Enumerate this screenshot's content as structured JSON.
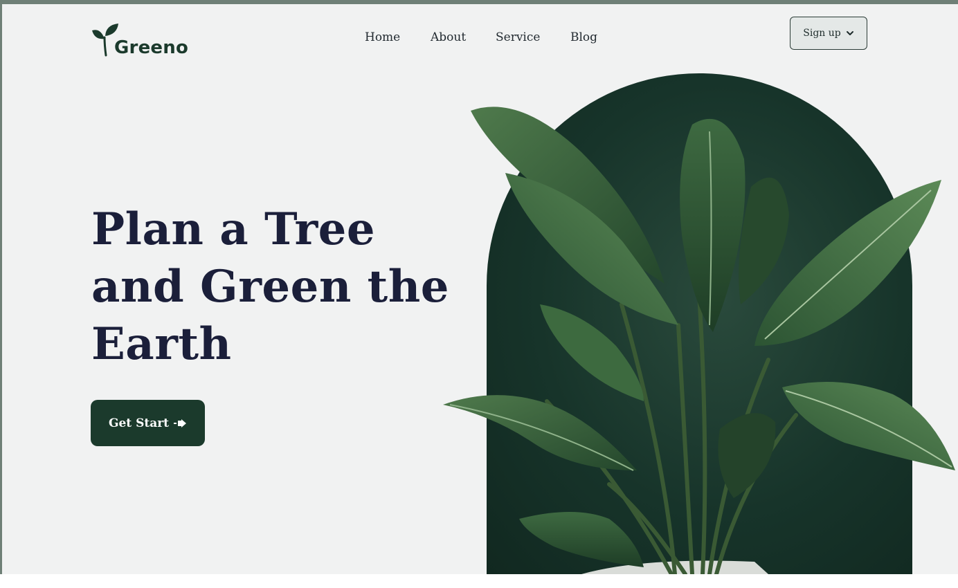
{
  "brand": {
    "name": "Greeno",
    "logo_icon": "sprout-icon",
    "color": "#1b3a2c"
  },
  "nav": {
    "items": [
      {
        "label": "Home"
      },
      {
        "label": "About"
      },
      {
        "label": "Service"
      },
      {
        "label": "Blog"
      }
    ],
    "signup_label": "Sign up",
    "signup_icon": "chevron-down-icon"
  },
  "hero": {
    "headline_lines": [
      "Plan a Tree",
      "and Green the",
      "Earth"
    ],
    "cta_label": "Get Start",
    "cta_icon": "arrow-right-icon",
    "image": "potted-plant",
    "colors": {
      "background": "#f1f2f2",
      "arch": "#17342a",
      "headline": "#1b1f3a",
      "button": "#1b3a2c"
    }
  }
}
